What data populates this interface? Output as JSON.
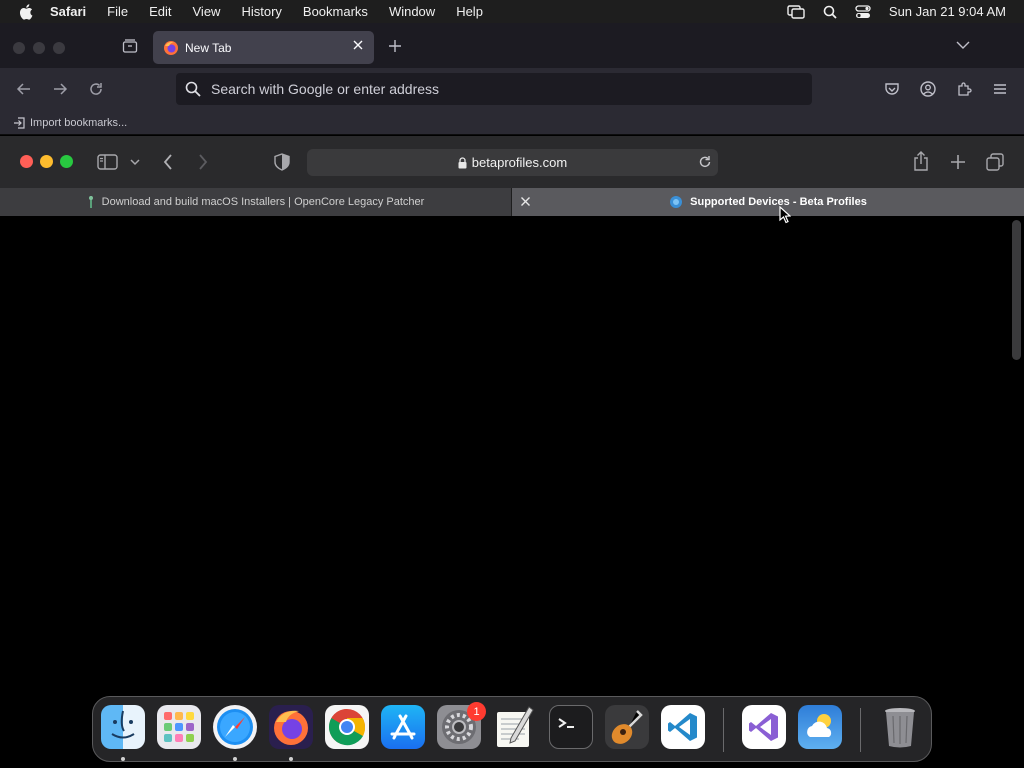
{
  "menubar": {
    "app_name": "Safari",
    "menus": [
      "File",
      "Edit",
      "View",
      "History",
      "Bookmarks",
      "Window",
      "Help"
    ],
    "clock": "Sun Jan 21  9:04 AM"
  },
  "firefox": {
    "tab_title": "New Tab",
    "url_placeholder": "Search with Google or enter address",
    "import_bookmarks": "Import bookmarks..."
  },
  "safari": {
    "address": "betaprofiles.com",
    "tabs": [
      {
        "title": "Download and build macOS Installers | OpenCore Legacy Patcher"
      },
      {
        "title": "Supported Devices - Beta Profiles"
      }
    ]
  },
  "dock": {
    "apps": [
      "Finder",
      "Launchpad",
      "Safari",
      "Firefox",
      "Chrome",
      "App Store",
      "System Settings",
      "TextEdit",
      "Terminal",
      "GarageBand",
      "Visual Studio Code",
      "Visual Studio",
      "Weather",
      "Trash"
    ],
    "settings_badge": "1"
  }
}
